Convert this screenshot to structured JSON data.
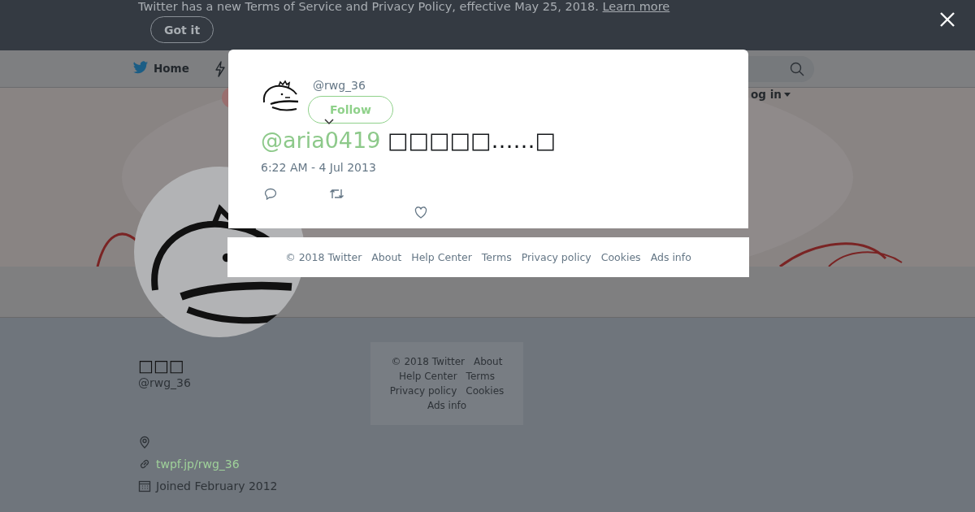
{
  "banner": {
    "text": "Twitter has a new Terms of Service and Privacy Policy, effective May 25, 2018.",
    "link": "Learn more",
    "button": "Got it"
  },
  "nav": {
    "home": "Home",
    "login": "og in"
  },
  "profile": {
    "name": "□□□",
    "handle": "@rwg_36",
    "website": "twpf.jp/rwg_36",
    "joined": "Joined February 2012"
  },
  "sidebar_footer": {
    "links": [
      "© 2018 Twitter",
      "About",
      "Help Center",
      "Terms",
      "Privacy policy",
      "Cookies",
      "Ads info"
    ]
  },
  "tweet_modal": {
    "handle": "@rwg_36",
    "follow_button": "Follow",
    "mention": "@aria0419",
    "text": "□□□□□……□",
    "time": "6:22 AM - 4 Jul 2013"
  },
  "modal_footer": {
    "links": [
      "© 2018 Twitter",
      "About",
      "Help Center",
      "Terms",
      "Privacy policy",
      "Cookies",
      "Ads info"
    ]
  }
}
